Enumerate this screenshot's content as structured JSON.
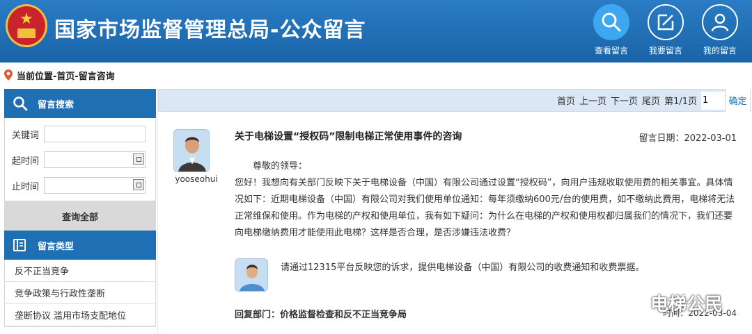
{
  "header": {
    "title": "国家市场监督管理总局-公众留言",
    "nav": [
      {
        "label": "查看留言",
        "icon": "search-icon"
      },
      {
        "label": "我要留言",
        "icon": "edit-icon"
      },
      {
        "label": "我的留言",
        "icon": "user-icon"
      }
    ]
  },
  "breadcrumb": "当前位置-首页-留言咨询",
  "sidebar": {
    "search_title": "留言搜索",
    "keyword_label": "关键词",
    "start_label": "起时间",
    "end_label": "止时间",
    "keyword_value": "",
    "start_value": "",
    "end_value": "",
    "query_all": "查询全部",
    "type_title": "留言类型",
    "types": [
      "反不正当竞争",
      "竞争政策与行政性垄断",
      "垄断协议 滥用市场支配地位"
    ]
  },
  "pager": {
    "first": "首页",
    "prev": "上一页",
    "next": "下一页",
    "last": "尾页",
    "page_info": "第1/1页",
    "page_value": "1",
    "confirm": "确定"
  },
  "message": {
    "user": "yooseohui",
    "title": "关于电梯设置“授权码”限制电梯正常使用事件的咨询",
    "date": "留言日期：2022-03-01",
    "greeting": "尊敬的领导：",
    "body": "您好！我想向有关部门反映下关于电梯设备（中国）有限公司通过设置“授权码”，向用户违规收取使用费的相关事宜。具体情况如下：近期电梯设备（中国）有限公司对我们使用单位通知：每年须缴纳600元/台的使用费，如不缴纳此费用，电梯将无法正常维保和使用。作为电梯的产权和使用单位，我有如下疑问：为什么在电梯的产权和使用权都归属我们的情况下，我们还要向电梯缴纳费用才能使用此电梯？这样是否合理，是否涉嫌违法收费？",
    "reply": "请通过12315平台反映您的诉求，提供电梯设备（中国）有限公司的收费通知和收费票据。",
    "reply_dept": "回复部门：价格监督检查和反不正当竞争局",
    "reply_time": "时间：2022-03-04"
  },
  "watermark": "电梯公民",
  "colors": {
    "header_blue": "#1f6fb5",
    "active_nav": "#3da7f0",
    "pager_bg": "#dbe7f5"
  }
}
